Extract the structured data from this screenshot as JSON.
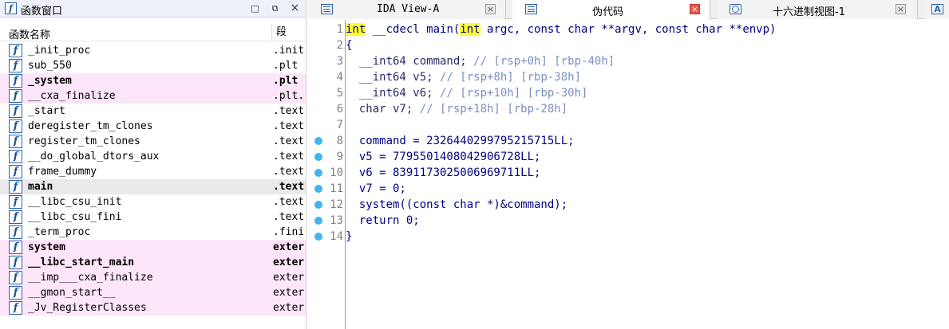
{
  "functions_window": {
    "title": "函数窗口",
    "title_icon": "f",
    "buttons": {
      "restore": "□",
      "float": "⧉",
      "close": "×"
    },
    "columns": {
      "name": "函数名称",
      "segment": "段"
    },
    "rows": [
      {
        "icon": "f",
        "name": "_init_proc",
        "segment": ".init",
        "highlight": "none",
        "bold": false
      },
      {
        "icon": "f",
        "name": "sub_550",
        "segment": ".plt",
        "highlight": "none",
        "bold": false
      },
      {
        "icon": "f",
        "name": "_system",
        "segment": ".plt",
        "highlight": "pink",
        "bold": true
      },
      {
        "icon": "f",
        "name": "__cxa_finalize",
        "segment": ".plt.",
        "highlight": "pink",
        "bold": false
      },
      {
        "icon": "f",
        "name": "_start",
        "segment": ".text",
        "highlight": "none",
        "bold": false
      },
      {
        "icon": "f",
        "name": "deregister_tm_clones",
        "segment": ".text",
        "highlight": "none",
        "bold": false
      },
      {
        "icon": "f",
        "name": "register_tm_clones",
        "segment": ".text",
        "highlight": "none",
        "bold": false
      },
      {
        "icon": "f",
        "name": "__do_global_dtors_aux",
        "segment": ".text",
        "highlight": "none",
        "bold": false
      },
      {
        "icon": "f",
        "name": "frame_dummy",
        "segment": ".text",
        "highlight": "none",
        "bold": false
      },
      {
        "icon": "f",
        "name": "main",
        "segment": ".text",
        "highlight": "selected",
        "bold": true
      },
      {
        "icon": "f",
        "name": "__libc_csu_init",
        "segment": ".text",
        "highlight": "none",
        "bold": false
      },
      {
        "icon": "f",
        "name": "__libc_csu_fini",
        "segment": ".text",
        "highlight": "none",
        "bold": false
      },
      {
        "icon": "f",
        "name": "_term_proc",
        "segment": ".fini",
        "highlight": "none",
        "bold": false
      },
      {
        "icon": "f",
        "name": "system",
        "segment": "exter",
        "highlight": "pink",
        "bold": true
      },
      {
        "icon": "f",
        "name": "__libc_start_main",
        "segment": "exter",
        "highlight": "pink",
        "bold": true
      },
      {
        "icon": "f",
        "name": "__imp___cxa_finalize",
        "segment": "exter",
        "highlight": "pink",
        "bold": false
      },
      {
        "icon": "f",
        "name": "__gmon_start__",
        "segment": "exter",
        "highlight": "pink",
        "bold": false
      },
      {
        "icon": "f",
        "name": "_Jv_RegisterClasses",
        "segment": "exter",
        "highlight": "pink",
        "bold": false
      }
    ]
  },
  "tabs": [
    {
      "label": "IDA View-A",
      "icon": "list-icon",
      "active": false,
      "close": "×"
    },
    {
      "label": "伪代码",
      "icon": "list-icon",
      "active": true,
      "close": "×"
    },
    {
      "label": "十六进制视图-1",
      "icon": "hex-icon",
      "active": false,
      "close": "×"
    },
    {
      "label": "",
      "icon": "A",
      "active": false,
      "close": ""
    }
  ],
  "code": {
    "lines": [
      {
        "num": "1",
        "bp": false,
        "parts": [
          {
            "t": "int",
            "c": "kw"
          },
          {
            "t": " __cdecl main(",
            "c": ""
          },
          {
            "t": "int",
            "c": "kw"
          },
          {
            "t": " argc, const char **argv, const char **envp)",
            "c": ""
          }
        ]
      },
      {
        "num": "2",
        "bp": false,
        "parts": [
          {
            "t": "{",
            "c": ""
          }
        ]
      },
      {
        "num": "3",
        "bp": false,
        "parts": [
          {
            "t": "  __int64 command; ",
            "c": "grey"
          },
          {
            "t": "// [rsp+0h] [rbp-40h]",
            "c": "cm"
          }
        ]
      },
      {
        "num": "4",
        "bp": false,
        "parts": [
          {
            "t": "  __int64 v5; ",
            "c": "grey"
          },
          {
            "t": "// [rsp+8h] [rbp-38h]",
            "c": "cm"
          }
        ]
      },
      {
        "num": "5",
        "bp": false,
        "parts": [
          {
            "t": "  __int64 v6; ",
            "c": "grey"
          },
          {
            "t": "// [rsp+10h] [rbp-30h]",
            "c": "cm"
          }
        ]
      },
      {
        "num": "6",
        "bp": false,
        "parts": [
          {
            "t": "  char v7; ",
            "c": "grey"
          },
          {
            "t": "// [rsp+18h] [rbp-28h]",
            "c": "cm"
          }
        ]
      },
      {
        "num": "7",
        "bp": false,
        "parts": [
          {
            "t": "",
            "c": ""
          }
        ]
      },
      {
        "num": "8",
        "bp": true,
        "parts": [
          {
            "t": "  command = 2326440299795215715LL;",
            "c": ""
          }
        ]
      },
      {
        "num": "9",
        "bp": true,
        "parts": [
          {
            "t": "  v5 = 7795501408042906728LL;",
            "c": ""
          }
        ]
      },
      {
        "num": "10",
        "bp": true,
        "parts": [
          {
            "t": "  v6 = 8391173025006969711LL;",
            "c": ""
          }
        ]
      },
      {
        "num": "11",
        "bp": true,
        "parts": [
          {
            "t": "  v7 = 0;",
            "c": ""
          }
        ]
      },
      {
        "num": "12",
        "bp": true,
        "parts": [
          {
            "t": "  system((const char *)&command);",
            "c": ""
          }
        ]
      },
      {
        "num": "13",
        "bp": true,
        "parts": [
          {
            "t": "  return 0;",
            "c": ""
          }
        ]
      },
      {
        "num": "14",
        "bp": true,
        "parts": [
          {
            "t": "}",
            "c": ""
          }
        ]
      }
    ]
  },
  "colors": {
    "keyword_bg": "#ffff33",
    "code_text": "#000080",
    "comment": "#7a8fc0",
    "breakpoint": "#3db5f0",
    "pink_row": "#fde6fa",
    "selected_row": "#eaeaea"
  }
}
